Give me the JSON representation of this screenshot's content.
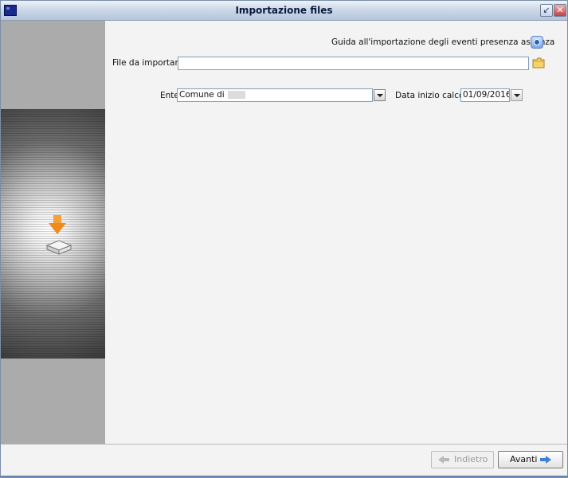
{
  "window": {
    "title": "Importazione files"
  },
  "help": {
    "label": "Guida all'importazione degli eventi presenza assenza",
    "icon": "help-icon"
  },
  "file_import": {
    "label": "File da importare",
    "value": "",
    "icon": "folder-icon"
  },
  "ente": {
    "label": "Ente",
    "value": "Comune di"
  },
  "data_inizio": {
    "label": "Data inizio calcolo",
    "value": "01/09/2016"
  },
  "buttons": {
    "back": "Indietro",
    "next": "Avanti"
  },
  "colors": {
    "titlebar": "#c6d3e6",
    "accent": "#3d7fd6",
    "sidebar": "#ababab",
    "field_border": "#7f9db9"
  }
}
